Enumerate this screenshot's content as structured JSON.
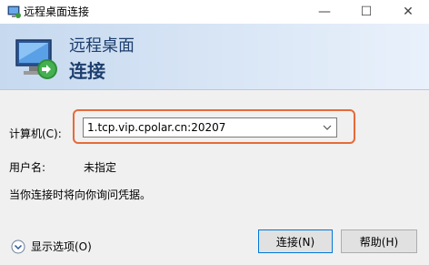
{
  "window": {
    "title": "远程桌面连接",
    "controls": {
      "minimize": "—",
      "maximize": "☐",
      "close": "✕"
    }
  },
  "header": {
    "line1": "远程桌面",
    "line2": "连接"
  },
  "form": {
    "computer_label": "计算机(C):",
    "computer_value": "1.tcp.vip.cpolar.cn:20207",
    "username_label": "用户名:",
    "username_value": "未指定",
    "hint": "当你连接时将向你询问凭据。"
  },
  "footer": {
    "show_options": "显示选项(O)",
    "connect_button": "连接(N)",
    "help_button": "帮助(H)"
  },
  "colors": {
    "highlight": "#e66a3a",
    "header_text": "#1d3f6e"
  }
}
